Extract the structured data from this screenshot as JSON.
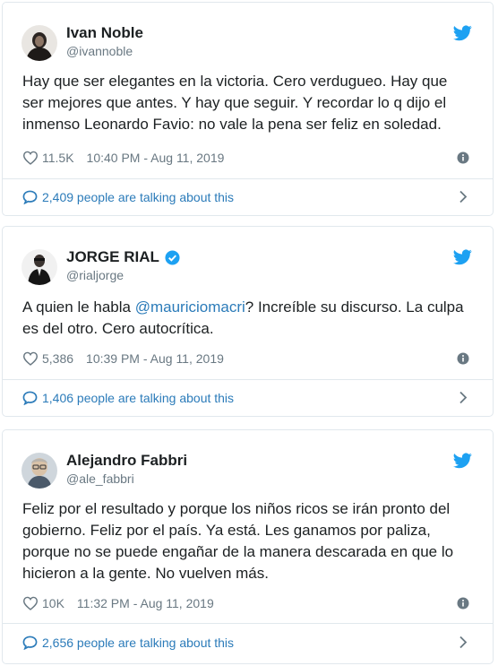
{
  "colors": {
    "link": "#2b7bb9",
    "muted": "#697882",
    "twitter_blue": "#1da1f2",
    "border": "#e1e8ed"
  },
  "tweets": [
    {
      "name": "Ivan Noble",
      "handle": "@ivannoble",
      "verified": false,
      "text": "Hay que ser elegantes en la victoria. Cero verdugueo. Hay que ser mejores que antes. Y hay que seguir. Y recordar lo q dijo el inmenso Leonardo Favio: no vale la pena ser feliz en soledad.",
      "likes": "11.5K",
      "timestamp": "10:40 PM - Aug 11, 2019",
      "talking": "2,409 people are talking about this"
    },
    {
      "name": "JORGE RIAL",
      "handle": "@rialjorge",
      "verified": true,
      "text_before": "A quien le habla ",
      "mention": "@mauriciomacri",
      "text_after": "? Increíble su discurso. La culpa es del otro. Cero autocrítica.",
      "likes": "5,386",
      "timestamp": "10:39 PM - Aug 11, 2019",
      "talking": "1,406 people are talking about this"
    },
    {
      "name": "Alejandro Fabbri",
      "handle": "@ale_fabbri",
      "verified": false,
      "text": "Feliz por el resultado y porque los niños ricos se irán pronto del gobierno. Feliz por el país. Ya está. Les ganamos por paliza, porque no se puede engañar de la manera descarada en que lo hicieron a la gente. No vuelven más.",
      "likes": "10K",
      "timestamp": "11:32 PM - Aug 11, 2019",
      "talking": "2,656 people are talking about this"
    }
  ],
  "icons": {
    "brand": "twitter-bird-icon",
    "like": "heart-icon",
    "info": "info-icon",
    "talk": "speech-bubble-icon",
    "more": "chevron-right-icon",
    "verified": "verified-badge-icon"
  }
}
